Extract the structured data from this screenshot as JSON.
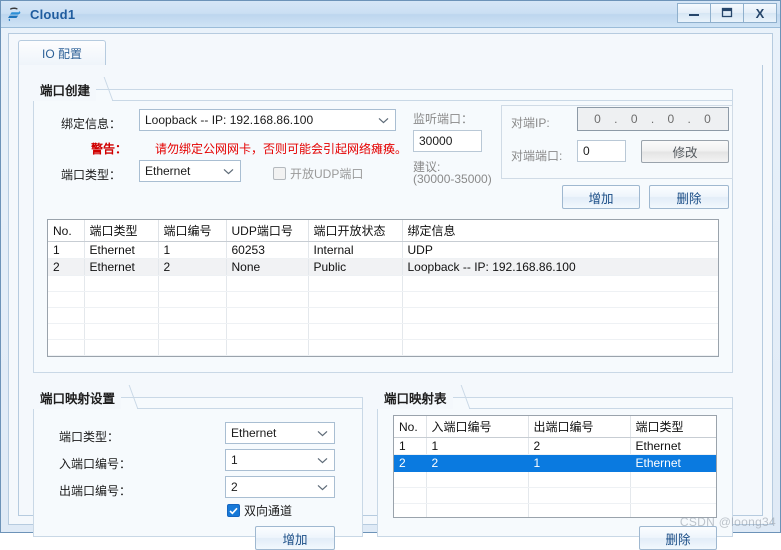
{
  "window": {
    "title": "Cloud1",
    "icon": "cloud-network-icon",
    "buttons": {
      "minimize": "minimize-icon",
      "maximize": "maximize-icon",
      "close": "X"
    }
  },
  "tabs": [
    {
      "label": "IO 配置",
      "active": true
    }
  ],
  "port_create": {
    "caption": "端口创建",
    "binding_label": "绑定信息：",
    "binding_value": "Loopback -- IP: 192.168.86.100",
    "warning_key": "警告：",
    "warning_text": "请勿绑定公网网卡，否则可能会引起网络瘫痪。",
    "port_type_label": "端口类型：",
    "port_type_value": "Ethernet",
    "udp_checkbox_label": "开放UDP端口",
    "udp_checkbox_checked": false,
    "listen_port_label": "监听端口：",
    "listen_port_value": "30000",
    "suggest_label": "建议:",
    "suggest_range": "(30000-35000)",
    "peer_ip_label": "对端IP:",
    "peer_ip_octets": [
      "0",
      "0",
      "0",
      "0"
    ],
    "peer_port_label": "对端端口:",
    "peer_port_value": "0",
    "modify_button": "修改",
    "add_button": "增加",
    "delete_button": "删除"
  },
  "port_table": {
    "headers": [
      "No.",
      "端口类型",
      "端口编号",
      "UDP端口号",
      "端口开放状态",
      "绑定信息"
    ],
    "rows": [
      [
        "1",
        "Ethernet",
        "1",
        "60253",
        "Internal",
        "UDP"
      ],
      [
        "2",
        "Ethernet",
        "2",
        "None",
        "Public",
        "Loopback -- IP: 192.168.86.100"
      ]
    ],
    "empty_rows": 5
  },
  "mapping_settings": {
    "caption": "端口映射设置",
    "port_type_label": "端口类型：",
    "port_type_value": "Ethernet",
    "in_port_label": "入端口编号：",
    "in_port_value": "1",
    "out_port_label": "出端口编号：",
    "out_port_value": "2",
    "bidirectional_label": "双向通道",
    "bidirectional_checked": true,
    "add_button": "增加"
  },
  "mapping_table": {
    "caption": "端口映射表",
    "headers": [
      "No.",
      "入端口编号",
      "出端口编号",
      "端口类型"
    ],
    "rows": [
      {
        "cells": [
          "1",
          "1",
          "2",
          "Ethernet"
        ],
        "selected": false
      },
      {
        "cells": [
          "2",
          "2",
          "1",
          "Ethernet"
        ],
        "selected": true
      }
    ],
    "empty_rows": 3,
    "delete_button": "删除"
  },
  "watermark": "CSDN @loong34",
  "colors": {
    "accent": "#1a4d86",
    "selection": "#0a7ae0",
    "warning": "#e40000",
    "title": "#1f5c9e"
  }
}
